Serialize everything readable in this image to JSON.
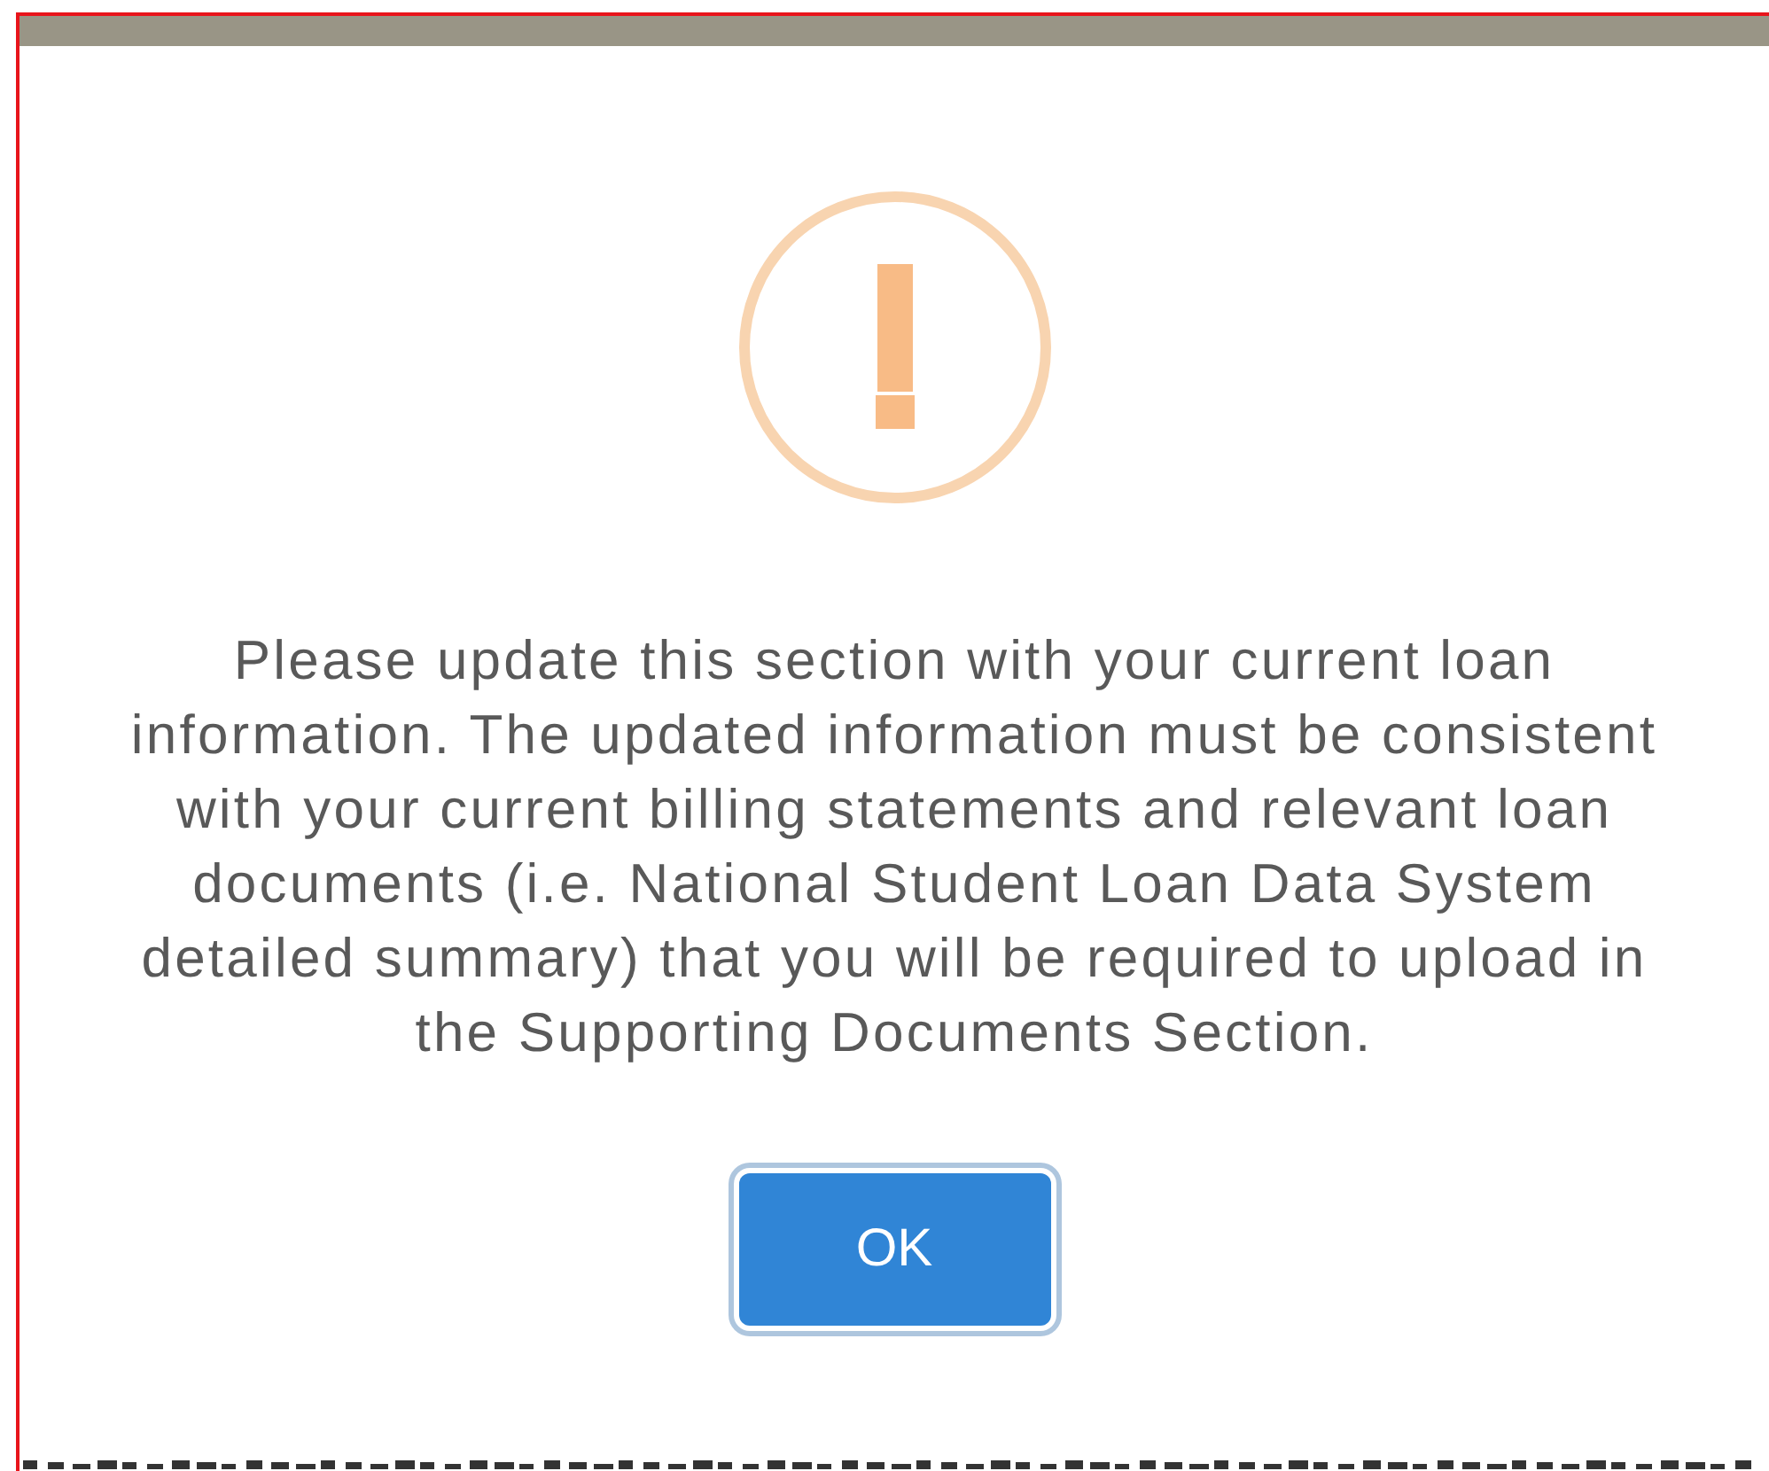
{
  "dialog": {
    "message": "Please update this section with your current loan information. The updated information must be consistent with your current billing statements and relevant loan documents (i.e. National Student Loan Data System detailed summary) that you will be required to upload in the Supporting Documents Section.",
    "buttons": [
      {
        "label": "OK"
      }
    ]
  }
}
